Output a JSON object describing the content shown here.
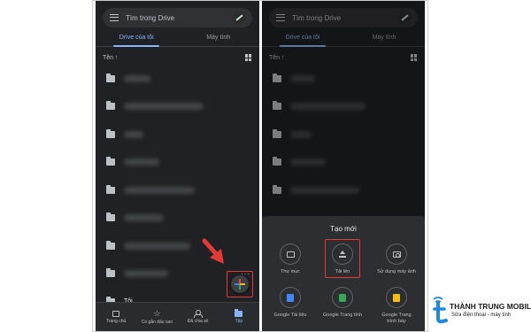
{
  "left_phone": {
    "search_placeholder": "Tìm trong Drive",
    "tabs": [
      {
        "label": "Drive của tôi",
        "active": true
      },
      {
        "label": "Máy tính",
        "active": false
      }
    ],
    "sort_label": "Tên ↑",
    "last_folder_name": "Tôi",
    "more_glyph": "···",
    "bottom_nav": [
      {
        "label": "Trang chủ",
        "icon": "home-icon",
        "active": false
      },
      {
        "label": "Có gắn dấu sao",
        "icon": "star-icon",
        "active": false
      },
      {
        "label": "Đã chia sẻ",
        "icon": "people-icon",
        "active": false
      },
      {
        "label": "Tệp",
        "icon": "folder-icon",
        "active": true
      }
    ]
  },
  "right_phone": {
    "search_placeholder": "Tìm trong Drive",
    "tabs": [
      {
        "label": "Drive của tôi",
        "active": true
      },
      {
        "label": "Máy tính",
        "active": false
      }
    ],
    "sort_label": "Tên ↑",
    "sheet": {
      "title": "Tạo mới",
      "options": [
        {
          "label": "Thư mục",
          "icon": "folder-icon"
        },
        {
          "label": "Tải lên",
          "icon": "upload-icon",
          "highlighted": true
        },
        {
          "label": "Sử dụng máy ảnh",
          "icon": "camera-icon"
        },
        {
          "label": "Google Tài liệu",
          "icon": "docs-icon"
        },
        {
          "label": "Google Trang tính",
          "icon": "sheets-icon"
        },
        {
          "label": "Google Trang trình bày",
          "icon": "slides-icon"
        }
      ]
    }
  },
  "watermark": {
    "name": "THÀNH TRUNG MOBILE",
    "slogan": "Sửa điện thoại - máy tính"
  },
  "colors": {
    "background": "#202124",
    "accent": "#8ab4f8",
    "highlight": "#e53935"
  }
}
